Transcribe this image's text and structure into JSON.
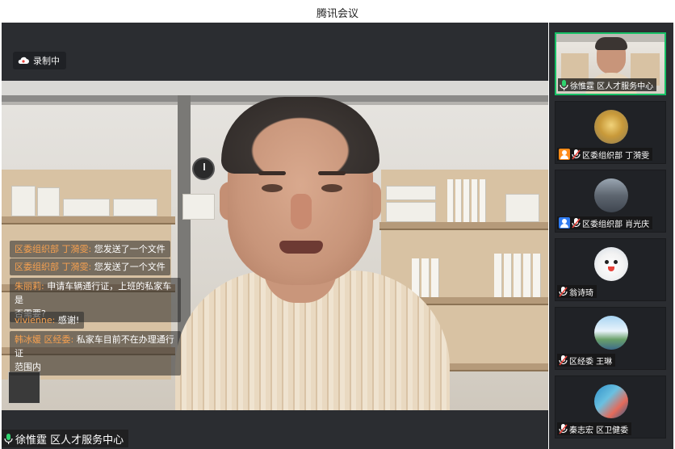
{
  "app": {
    "title": "腾讯会议"
  },
  "recording": {
    "label": "录制中"
  },
  "chat": {
    "messages": [
      {
        "sender": "区委组织部 丁漪雯:",
        "text": "您发送了一个文件"
      },
      {
        "sender": "区委组织部 丁漪雯:",
        "text": "您发送了一个文件"
      },
      {
        "sender": "朱丽莉:",
        "text": "申请车辆通行证，上班的私家车是",
        "text2": "否需要?"
      },
      {
        "sender": "vivienne:",
        "text": "感谢!"
      },
      {
        "sender": "韩冰媛 区经委:",
        "text": "私家车目前不在办理通行证",
        "text2": "范围内"
      }
    ]
  },
  "speaker": {
    "name": "徐惟霆 区人才服务中心"
  },
  "participants": [
    {
      "name": "徐惟霆 区人才服务中心",
      "type": "video",
      "active": true,
      "badge": "mic"
    },
    {
      "name": "区委组织部 丁漪雯",
      "type": "avatar",
      "avatar": "landscape-gold",
      "badge": "orange"
    },
    {
      "name": "区委组织部 肖光庆",
      "type": "avatar",
      "avatar": "city",
      "badge": "blue"
    },
    {
      "name": "翁诗琦",
      "type": "avatar",
      "avatar": "rabbit",
      "badge": "none"
    },
    {
      "name": "区经委 王琳",
      "type": "avatar",
      "avatar": "sky",
      "badge": "none"
    },
    {
      "name": "秦志宏 区卫健委",
      "type": "avatar",
      "avatar": "ocean",
      "badge": "none"
    }
  ],
  "icons": {
    "recording": "cloud-icon",
    "mic_on": "mic-icon",
    "mic_muted": "mic-muted-icon",
    "role_orange": "user-orange-icon",
    "role_blue": "user-blue-icon"
  },
  "colors": {
    "accent": "#16c066",
    "chat_sender": "#f5a050",
    "bg": "#2b2d31"
  }
}
